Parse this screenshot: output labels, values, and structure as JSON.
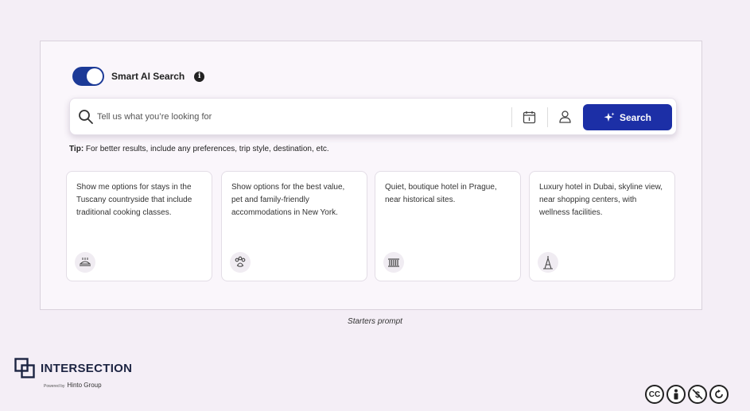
{
  "toggle": {
    "label": "Smart AI Search",
    "on": true
  },
  "search": {
    "placeholder": "Tell us what you’re looking for",
    "button_label": "Search"
  },
  "tip": {
    "label": "Tip:",
    "text": " For better results, include any preferences, trip style, destination, etc."
  },
  "cards": [
    {
      "text": "Show me options for stays in the Tuscany countryside that include traditional cooking classes.",
      "icon": "cooking-icon"
    },
    {
      "text": "Show options for the best value, pet and family-friendly accommodations in New York.",
      "icon": "paw-icon"
    },
    {
      "text": "Quiet, boutique hotel in Prague, near historical sites.",
      "icon": "bridge-icon"
    },
    {
      "text": "Luxury hotel in Dubai, skyline view, near shopping centers, with wellness facilities.",
      "icon": "tower-icon"
    }
  ],
  "caption": "Starters prompt",
  "brand": {
    "name": "INTERSECTION",
    "powered_prefix": "Powered by",
    "powered_by": "Hinto Group"
  },
  "license": [
    "CC",
    "BY",
    "NC",
    "SA"
  ],
  "colors": {
    "accent": "#1c2fa6",
    "toggle": "#1c3a97",
    "background": "#f4eef6"
  }
}
